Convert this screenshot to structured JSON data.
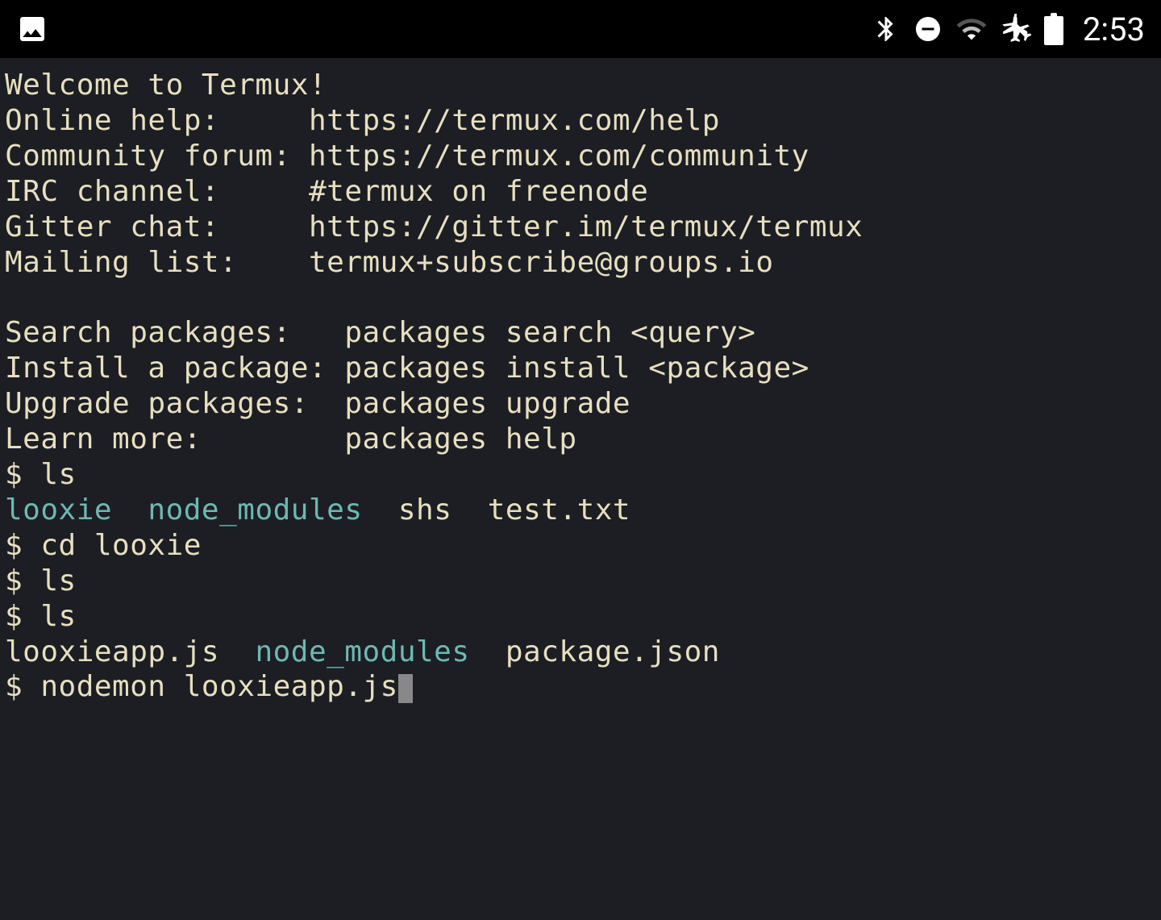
{
  "status_bar": {
    "time": "2:53"
  },
  "terminal": {
    "welcome": "Welcome to Termux!",
    "blank": "",
    "help_label": "Online help:     ",
    "help_value": "https://termux.com/help",
    "forum_label": "Community forum: ",
    "forum_value": "https://termux.com/community",
    "irc_label": "IRC channel:     ",
    "irc_value": "#termux on freenode",
    "gitter_label": "Gitter chat:     ",
    "gitter_value": "https://gitter.im/termux/termux",
    "mailing_label": "Mailing list:    ",
    "mailing_value": "termux+subscribe@groups.io",
    "search_label": "Search packages:   ",
    "search_value": "packages search <query>",
    "install_label": "Install a package: ",
    "install_value": "packages install <package>",
    "upgrade_label": "Upgrade packages:  ",
    "upgrade_value": "packages upgrade",
    "learn_label": "Learn more:        ",
    "learn_value": "packages help",
    "prompt1": "$ ls",
    "ls1_dir1": "looxie",
    "ls1_sep1": "  ",
    "ls1_dir2": "node_modules",
    "ls1_rest": "  shs  test.txt",
    "prompt2": "$ cd looxie",
    "prompt3": "$ ls",
    "prompt4": "$ ls",
    "ls2_file1": "looxieapp.js  ",
    "ls2_dir1": "node_modules",
    "ls2_rest": "  package.json",
    "prompt5": "$ nodemon looxieapp.js"
  }
}
